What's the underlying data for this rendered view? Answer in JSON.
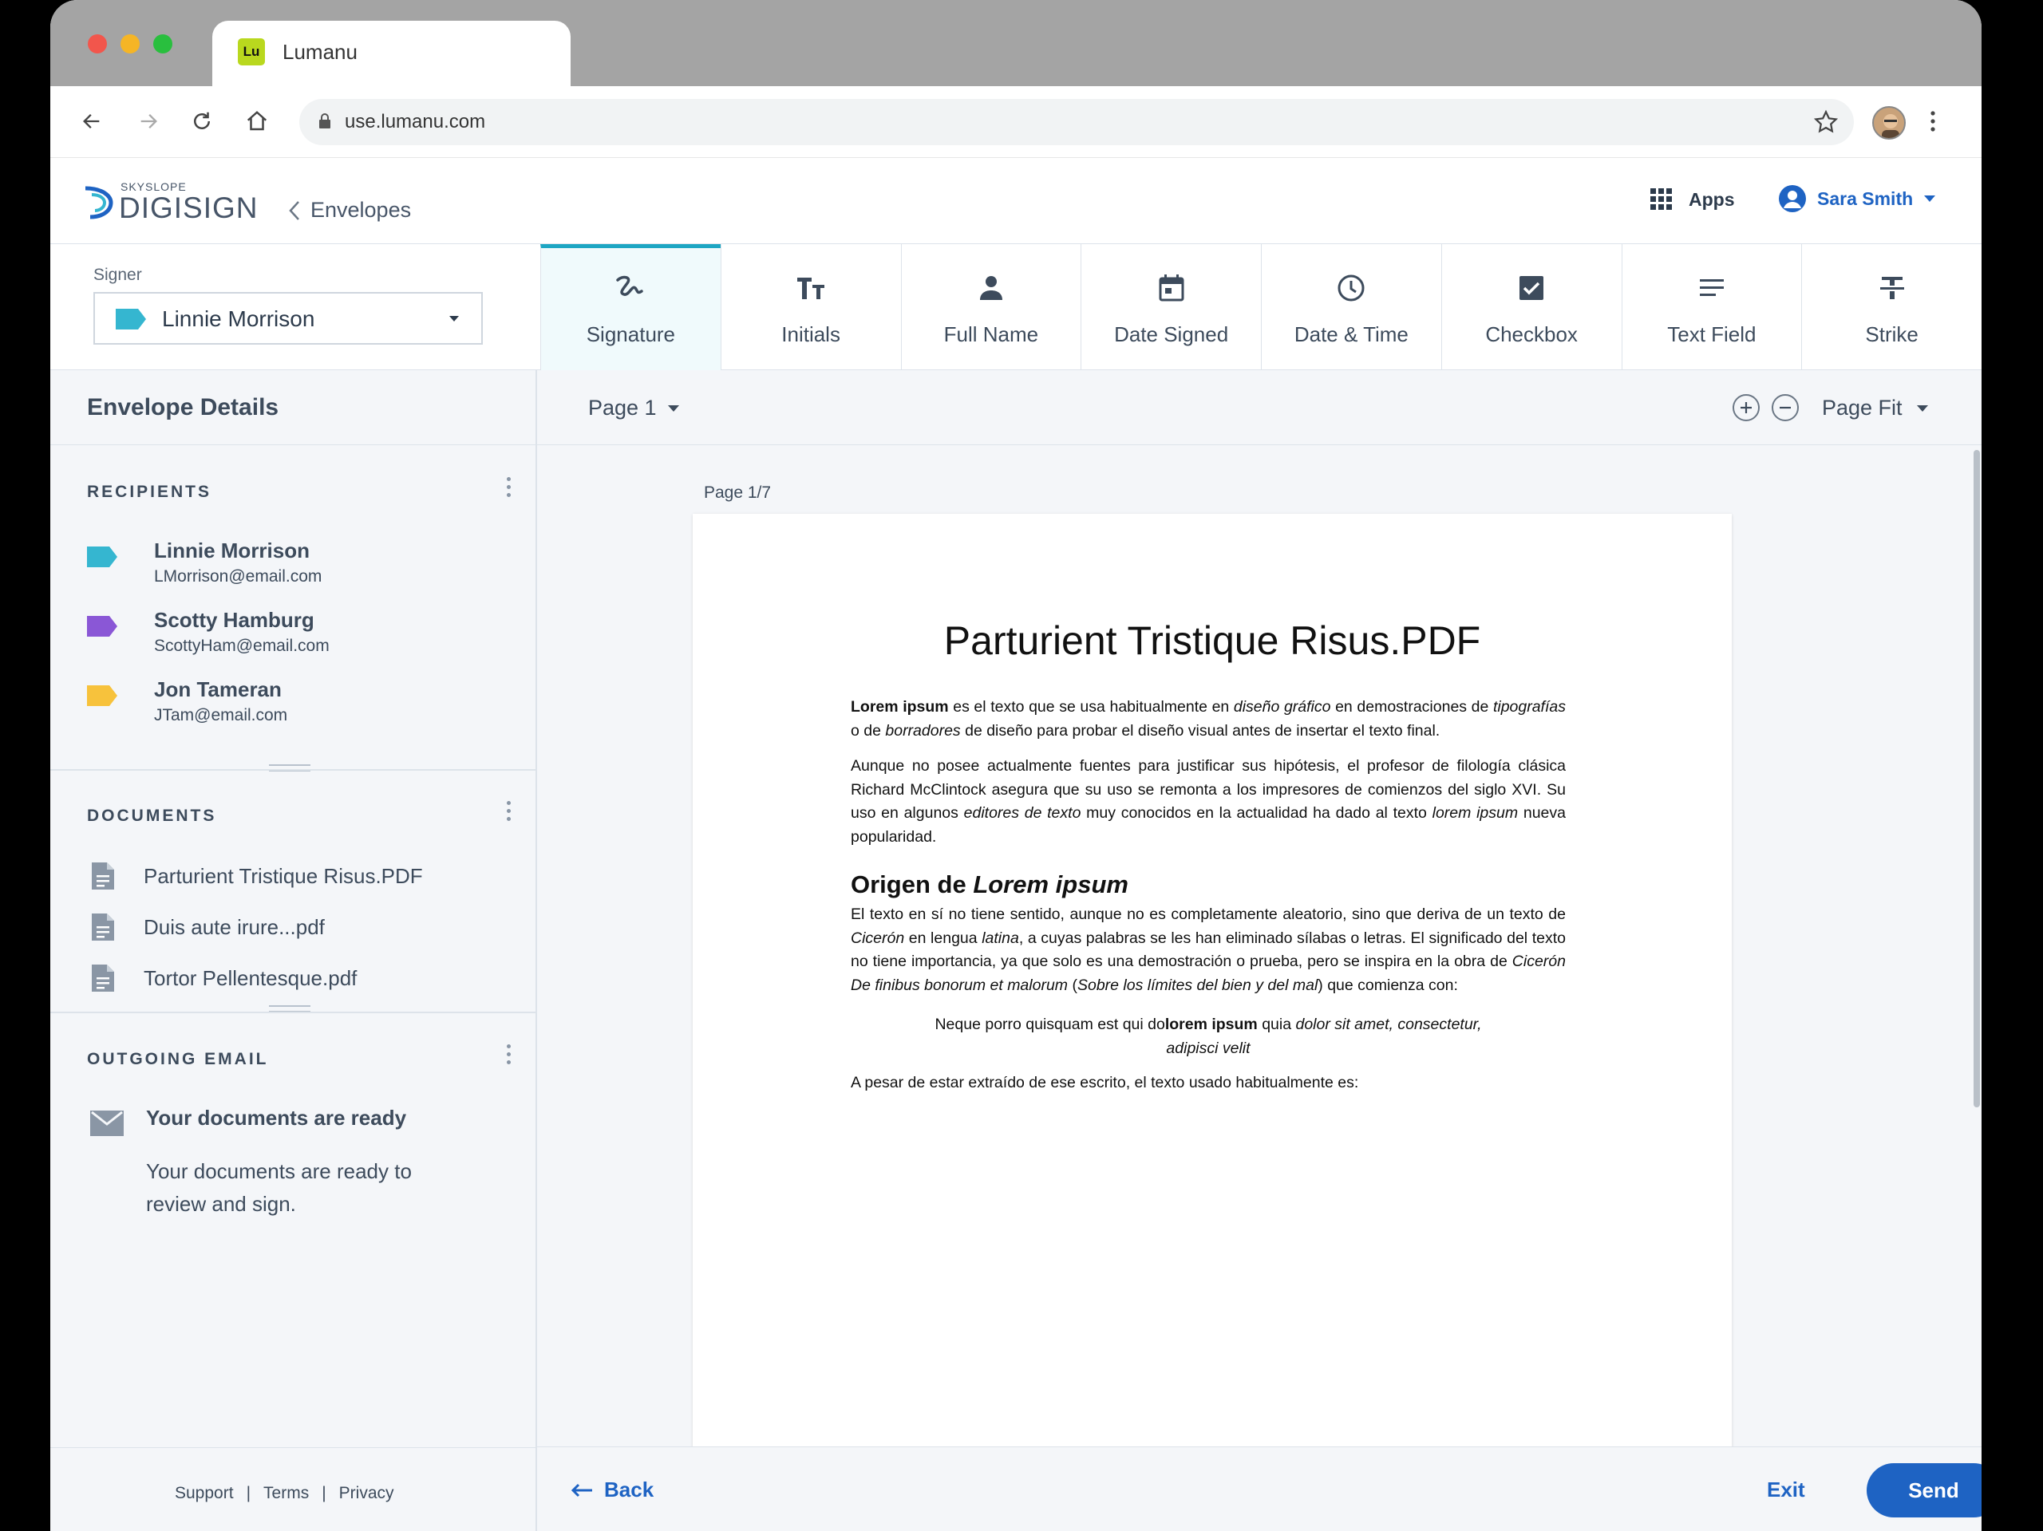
{
  "browser": {
    "tab_title": "Lumanu",
    "favicon_text": "Lu",
    "url": "use.lumanu.com"
  },
  "header": {
    "logo_top": "SKYSLOPE",
    "logo_main": "DIGISIGN",
    "back_link": "Envelopes",
    "apps_label": "Apps",
    "user_name": "Sara Smith"
  },
  "signer": {
    "label": "Signer",
    "selected": "Linnie Morrison",
    "selected_color": "#35b6d0"
  },
  "tools": [
    {
      "label": "Signature",
      "icon": "signature-icon",
      "active": true
    },
    {
      "label": "Initials",
      "icon": "initials-icon"
    },
    {
      "label": "Full Name",
      "icon": "person-icon"
    },
    {
      "label": "Date Signed",
      "icon": "calendar-icon"
    },
    {
      "label": "Date & Time",
      "icon": "clock-icon"
    },
    {
      "label": "Checkbox",
      "icon": "checkbox-icon"
    },
    {
      "label": "Text Field",
      "icon": "text-lines-icon"
    },
    {
      "label": "Strike",
      "icon": "strikethrough-icon"
    }
  ],
  "sidebar": {
    "title": "Envelope Details",
    "recipients_title": "RECIPIENTS",
    "recipients": [
      {
        "name": "Linnie Morrison",
        "email": "LMorrison@email.com",
        "color": "#35b6d0"
      },
      {
        "name": "Scotty Hamburg",
        "email": "ScottyHam@email.com",
        "color": "#8a57d6"
      },
      {
        "name": "Jon Tameran",
        "email": "JTam@email.com",
        "color": "#f7c23c"
      }
    ],
    "documents_title": "DOCUMENTS",
    "documents": [
      {
        "name": "Parturient Tristique Risus.PDF"
      },
      {
        "name": "Duis aute irure...pdf"
      },
      {
        "name": "Tortor Pellentesque.pdf"
      }
    ],
    "email_title": "OUTGOING EMAIL",
    "email_subject": "Your documents are ready",
    "email_body": "Your documents are ready to review and sign.",
    "footer_links": [
      "Support",
      "Terms",
      "Privacy"
    ]
  },
  "viewer": {
    "page_select": "Page 1",
    "zoom_mode": "Page Fit",
    "page_count": "Page 1/7"
  },
  "document": {
    "title": "Parturient Tristique Risus.PDF",
    "heading": "Origen de Lorem ipsum",
    "last_line": "A pesar de estar extraído de ese escrito, el texto usado habitualmente es:"
  },
  "actions": {
    "back": "Back",
    "exit": "Exit",
    "send": "Send"
  },
  "colors": {
    "accent": "#1e63c3",
    "active_tab": "#1da6c3"
  }
}
